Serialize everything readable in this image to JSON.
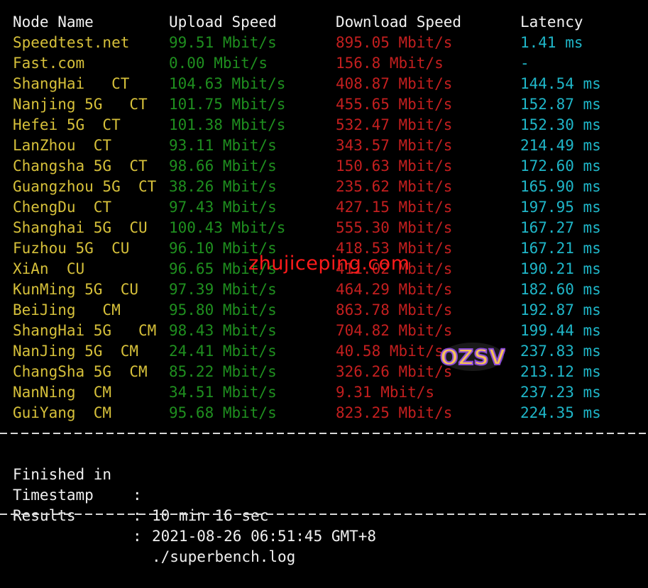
{
  "header": {
    "node": "Node Name",
    "upload": "Upload Speed",
    "download": "Download Speed",
    "latency": "Latency"
  },
  "rows": [
    {
      "node": "Speedtest.net",
      "upload": "99.51 Mbit/s",
      "download": "895.05 Mbit/s",
      "latency": "1.41 ms"
    },
    {
      "node": "Fast.com",
      "upload": "0.00 Mbit/s",
      "download": "156.8 Mbit/s",
      "latency": "-"
    },
    {
      "node": "ShangHai   CT",
      "upload": "104.63 Mbit/s",
      "download": "408.87 Mbit/s",
      "latency": "144.54 ms"
    },
    {
      "node": "Nanjing 5G   CT",
      "upload": "101.75 Mbit/s",
      "download": "455.65 Mbit/s",
      "latency": "152.87 ms"
    },
    {
      "node": "Hefei 5G  CT",
      "upload": "101.38 Mbit/s",
      "download": "532.47 Mbit/s",
      "latency": "152.30 ms"
    },
    {
      "node": "LanZhou  CT",
      "upload": "93.11 Mbit/s",
      "download": "343.57 Mbit/s",
      "latency": "214.49 ms"
    },
    {
      "node": "Changsha 5G  CT",
      "upload": "98.66 Mbit/s",
      "download": "150.63 Mbit/s",
      "latency": "172.60 ms"
    },
    {
      "node": "Guangzhou 5G  CT",
      "upload": "38.26 Mbit/s",
      "download": "235.62 Mbit/s",
      "latency": "165.90 ms"
    },
    {
      "node": "ChengDu  CT",
      "upload": "97.43 Mbit/s",
      "download": "427.15 Mbit/s",
      "latency": "197.95 ms"
    },
    {
      "node": "Shanghai 5G  CU",
      "upload": "100.43 Mbit/s",
      "download": "555.30 Mbit/s",
      "latency": "167.27 ms"
    },
    {
      "node": "Fuzhou 5G  CU",
      "upload": "96.10 Mbit/s",
      "download": "418.53 Mbit/s",
      "latency": "167.21 ms"
    },
    {
      "node": "XiAn  CU",
      "upload": "96.65 Mbit/s",
      "download": "411.02 Mbit/s",
      "latency": "190.21 ms"
    },
    {
      "node": "KunMing 5G  CU",
      "upload": "97.39 Mbit/s",
      "download": "464.29 Mbit/s",
      "latency": "182.60 ms"
    },
    {
      "node": "BeiJing   CM",
      "upload": "95.80 Mbit/s",
      "download": "863.78 Mbit/s",
      "latency": "192.87 ms"
    },
    {
      "node": "ShangHai 5G   CM",
      "upload": "98.43 Mbit/s",
      "download": "704.82 Mbit/s",
      "latency": "199.44 ms"
    },
    {
      "node": "NanJing 5G  CM",
      "upload": "24.41 Mbit/s",
      "download": "40.58 Mbit/s",
      "latency": "237.83 ms"
    },
    {
      "node": "ChangSha 5G  CM",
      "upload": "85.22 Mbit/s",
      "download": "326.26 Mbit/s",
      "latency": "213.12 ms"
    },
    {
      "node": "NanNing  CM",
      "upload": "34.51 Mbit/s",
      "download": "9.31 Mbit/s",
      "latency": "237.23 ms"
    },
    {
      "node": "GuiYang  CM",
      "upload": "95.68 Mbit/s",
      "download": "823.25 Mbit/s",
      "latency": "224.35 ms"
    }
  ],
  "summary": {
    "finished_label": "Finished in",
    "finished_value": "10 min 16 sec",
    "timestamp_label": "Timestamp",
    "timestamp_value": "2021-08-26 06:51:45 GMT+8",
    "results_label": "Results",
    "results_value": "./superbench.log",
    "separator": ":"
  },
  "watermark": {
    "text": "zhujiceping.com",
    "color": "#ff1b1b"
  },
  "logo": {
    "text": "OZSV"
  },
  "colors": {
    "node": "#d6c03a",
    "upload": "#1f8f1f",
    "download": "#c41f1f",
    "latency": "#1fb6c8",
    "background": "#000000"
  }
}
